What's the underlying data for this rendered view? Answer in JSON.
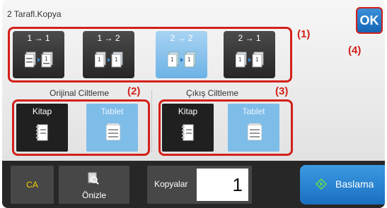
{
  "dialog": {
    "title": "2 Tarafl.Kopya",
    "ok_label": "OK"
  },
  "callouts": {
    "c1": "(1)",
    "c2": "(2)",
    "c3": "(3)",
    "c4": "(4)"
  },
  "copy_modes": [
    {
      "label": "1 → 1",
      "selected": false,
      "icon": "one-to-one-sided-icon"
    },
    {
      "label": "1 → 2",
      "selected": false,
      "icon": "one-to-two-sided-icon"
    },
    {
      "label": "2 → 2",
      "selected": true,
      "icon": "two-to-two-sided-icon"
    },
    {
      "label": "2 → 1",
      "selected": false,
      "icon": "two-to-one-sided-icon"
    }
  ],
  "original_binding": {
    "label": "Orijinal Ciltleme",
    "options": [
      {
        "label": "Kitap",
        "selected": false,
        "icon": "book-binding-icon"
      },
      {
        "label": "Tablet",
        "selected": true,
        "icon": "tablet-binding-icon"
      }
    ]
  },
  "output_binding": {
    "label": "Çıkış Ciltleme",
    "options": [
      {
        "label": "Kitap",
        "selected": false,
        "icon": "book-binding-icon"
      },
      {
        "label": "Tablet",
        "selected": true,
        "icon": "tablet-binding-icon"
      }
    ]
  },
  "bottom_bar": {
    "ca_label": "CA",
    "preview_label": "Önizle",
    "copies_label": "Kopyalar",
    "copies_value": "1",
    "start_label": "Baslama"
  },
  "colors": {
    "callout_red": "#d3201a",
    "selected_blue": "#7fbde9",
    "ok_blue": "#1a6fc0",
    "ca_yellow": "#f0d000",
    "start_icon_green": "#5fd35f"
  }
}
